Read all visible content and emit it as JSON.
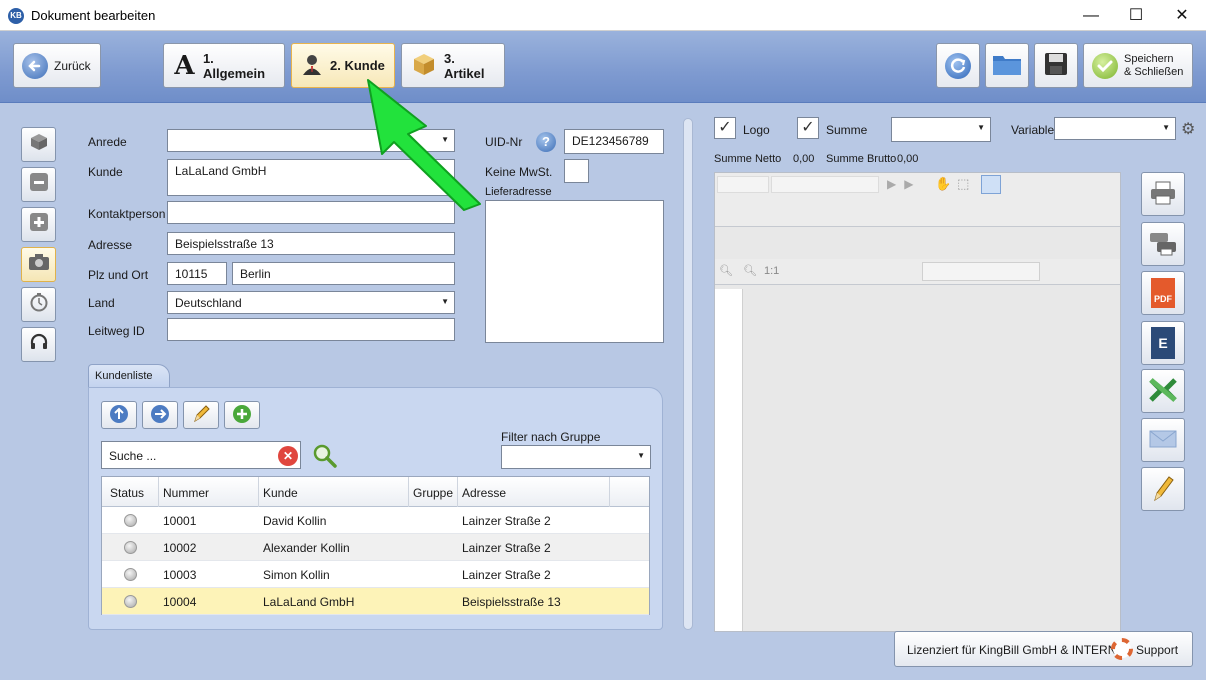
{
  "window": {
    "app_icon_text": "KB",
    "title": "Dokument bearbeiten",
    "minimize": "—",
    "maximize": "☐",
    "close": "✕"
  },
  "toolbar": {
    "back_label": "Zurück",
    "tabs": [
      {
        "label": "1. Allgemein",
        "icon_glyph": "A"
      },
      {
        "label": "2. Kunde"
      },
      {
        "label": "3. Artikel"
      }
    ],
    "save_close_label_1": "Speichern",
    "save_close_label_2": "& Schließen"
  },
  "form": {
    "anrede_label": "Anrede",
    "anrede_value": "",
    "kunde_label": "Kunde",
    "kunde_value": "LaLaLand GmbH",
    "kontakt_label": "Kontaktperson",
    "kontakt_value": "",
    "adresse_label": "Adresse",
    "adresse_value": "Beispielsstraße 13",
    "plz_label": "Plz und Ort",
    "plz_value": "10115",
    "ort_value": "Berlin",
    "land_label": "Land",
    "land_value": "Deutschland",
    "leitweg_label": "Leitweg ID",
    "leitweg_value": "",
    "uid_label": "UID-Nr",
    "uid_value": "DE123456789",
    "help_glyph": "?",
    "keine_mwst_label": "Keine MwSt.",
    "lieferadresse_label": "Lieferadresse",
    "lieferadresse_value": ""
  },
  "kundenliste": {
    "tab_label": "Kundenliste",
    "search_placeholder": "Suche ...",
    "filter_label": "Filter nach Gruppe",
    "filter_value": "",
    "columns": [
      "Status",
      "Nummer",
      "Kunde",
      "Gruppe",
      "Adresse"
    ],
    "rows": [
      {
        "nummer": "10001",
        "kunde": "David Kollin",
        "gruppe": "",
        "adresse": "Lainzer Straße 2"
      },
      {
        "nummer": "10002",
        "kunde": "Alexander Kollin",
        "gruppe": "",
        "adresse": "Lainzer Straße 2"
      },
      {
        "nummer": "10003",
        "kunde": "Simon Kollin",
        "gruppe": "",
        "adresse": "Lainzer Straße 2"
      },
      {
        "nummer": "10004",
        "kunde": "LaLaLand GmbH",
        "gruppe": "",
        "adresse": "Beispielsstraße 13"
      }
    ]
  },
  "preview": {
    "logo_label": "Logo",
    "logo_checked": "✓",
    "summe_label": "Summe",
    "summe_checked": "✓",
    "variable_label": "Variable",
    "summe_netto_label": "Summe Netto",
    "summe_netto_value": "0,00",
    "summe_brutto_label": "Summe Brutto",
    "summe_brutto_value": "0,00",
    "zoom_label": "1:1",
    "pdf_label": "PDF",
    "e_label": "E"
  },
  "status": {
    "license_text": "Lizenziert für KingBill GmbH & INTERN",
    "support_label": "Support"
  },
  "colors": {
    "toolbar": "#7e9ad0",
    "body": "#b8c8e4",
    "active_tab": "#f7e8b8",
    "selected_row": "#fdf3b8",
    "annotation_arrow": "#22e23c"
  }
}
